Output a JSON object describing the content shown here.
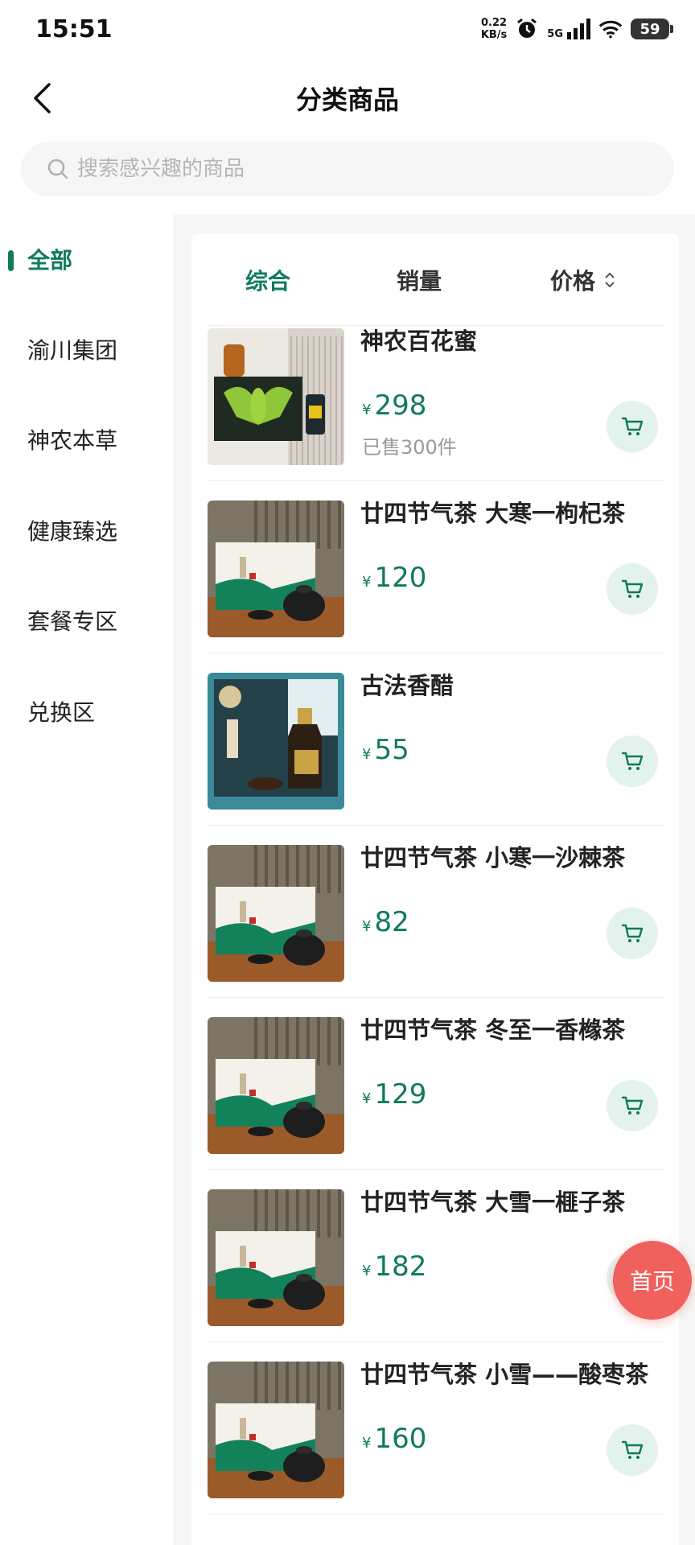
{
  "status_bar": {
    "time": "15:51",
    "net_speed_value": "0.22",
    "net_speed_unit": "KB/s",
    "net_type": "5G",
    "battery": "59"
  },
  "header": {
    "title": "分类商品"
  },
  "search": {
    "placeholder": "搜索感兴趣的商品"
  },
  "sidebar": {
    "items": [
      {
        "label": "全部",
        "active": true
      },
      {
        "label": "渝川集团"
      },
      {
        "label": "神农本草"
      },
      {
        "label": "健康臻选"
      },
      {
        "label": "套餐专区"
      },
      {
        "label": "兑换区"
      }
    ]
  },
  "sort": {
    "tabs": [
      {
        "label": "综合",
        "active": true
      },
      {
        "label": "销量"
      },
      {
        "label": "价格"
      }
    ]
  },
  "products": [
    {
      "name": "神农百花蜜",
      "currency": "¥",
      "price": "298",
      "sold": "已售300件",
      "image": "honey-gift-box"
    },
    {
      "name": "廿四节气茶 大寒一枸杞茶",
      "currency": "¥",
      "price": "120",
      "image": "tea-gift-box"
    },
    {
      "name": "古法香醋",
      "currency": "¥",
      "price": "55",
      "image": "vinegar-bottle"
    },
    {
      "name": "廿四节气茶 小寒一沙棘茶",
      "currency": "¥",
      "price": "82",
      "image": "tea-gift-box"
    },
    {
      "name": "廿四节气茶 冬至一香橼茶",
      "currency": "¥",
      "price": "129",
      "image": "tea-gift-box"
    },
    {
      "name": "廿四节气茶 大雪一榧子茶",
      "currency": "¥",
      "price": "182",
      "image": "tea-gift-box"
    },
    {
      "name": "廿四节气茶 小雪——酸枣茶",
      "currency": "¥",
      "price": "160",
      "image": "tea-gift-box"
    }
  ],
  "home_button": {
    "label": "首页"
  },
  "colors": {
    "accent": "#0f7a5c",
    "cart_bg": "#e4f2ed",
    "home_float": "#f0605c"
  },
  "icons": [
    "back-icon",
    "search-icon",
    "cart-icon",
    "sort-arrows-icon",
    "wifi-icon",
    "signal-icon",
    "alarm-icon"
  ]
}
